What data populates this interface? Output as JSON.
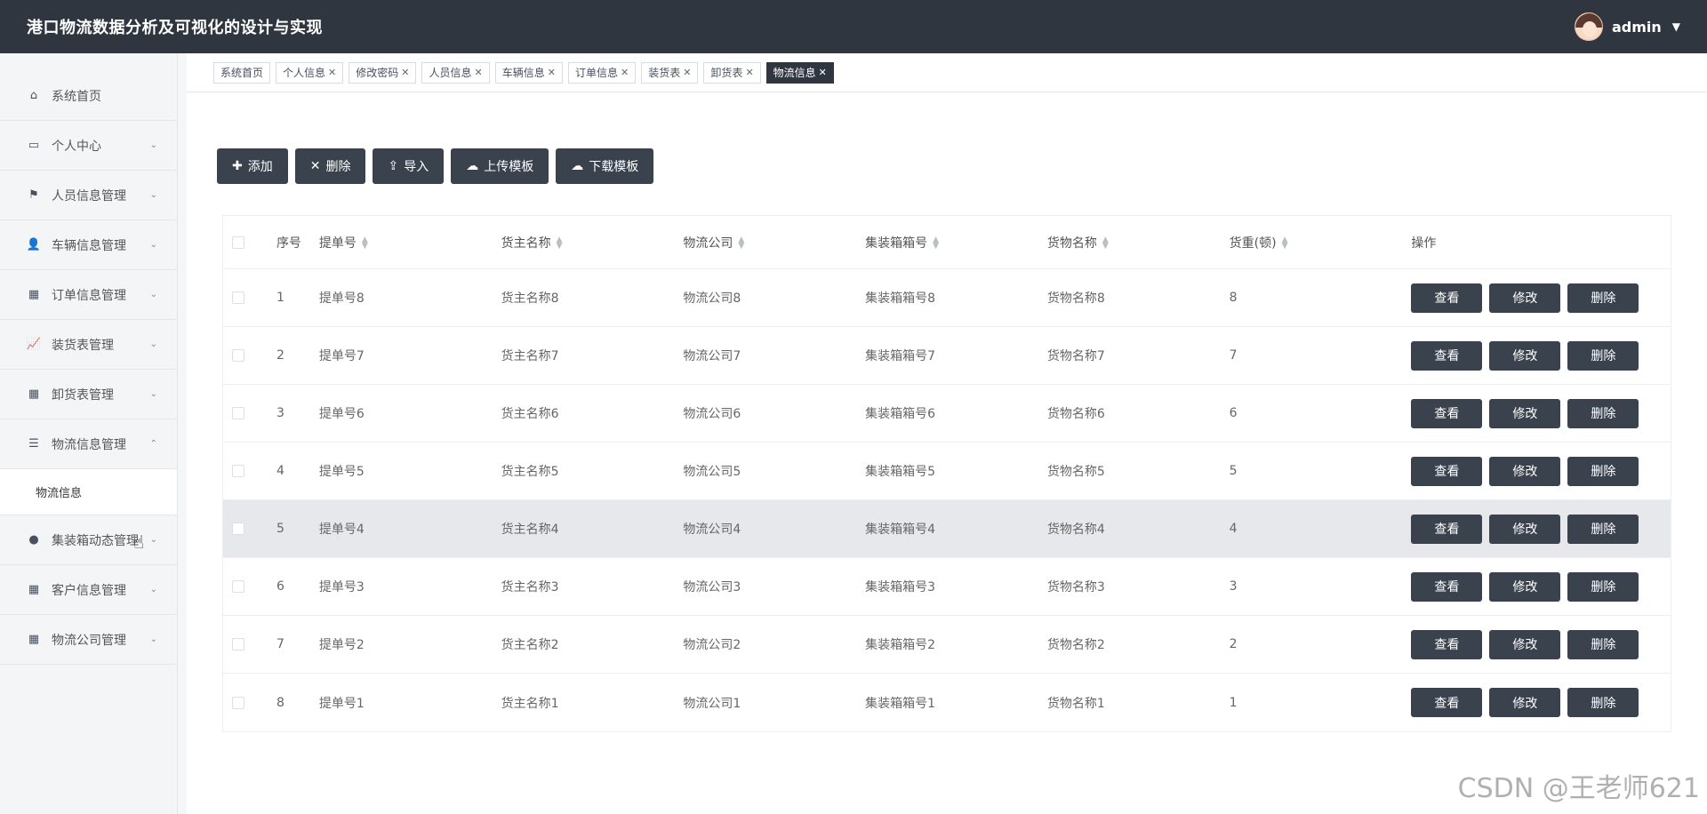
{
  "app": {
    "title": "港口物流数据分析及可视化的设计与实现",
    "user": "admin",
    "caret": "▼"
  },
  "sidebar": {
    "items": [
      {
        "label": "系统首页",
        "icon": "home-icon",
        "glyph": "⌂",
        "has_chevron": false
      },
      {
        "label": "个人中心",
        "icon": "calendar-icon",
        "glyph": "▭",
        "has_chevron": true,
        "chevron": "⌄"
      },
      {
        "label": "人员信息管理",
        "icon": "flag-icon",
        "glyph": "⚑",
        "has_chevron": true,
        "chevron": "⌄"
      },
      {
        "label": "车辆信息管理",
        "icon": "user-icon",
        "glyph": "👤",
        "has_chevron": true,
        "chevron": "⌄"
      },
      {
        "label": "订单信息管理",
        "icon": "grid-icon",
        "glyph": "▦",
        "has_chevron": true,
        "chevron": "⌄"
      },
      {
        "label": "装货表管理",
        "icon": "chart-icon",
        "glyph": "📈",
        "has_chevron": true,
        "chevron": "⌄"
      },
      {
        "label": "卸货表管理",
        "icon": "grid-icon",
        "glyph": "▦",
        "has_chevron": true,
        "chevron": "⌄"
      },
      {
        "label": "物流信息管理",
        "icon": "list-icon",
        "glyph": "☰",
        "has_chevron": true,
        "chevron": "⌃",
        "expanded": true
      },
      {
        "label": "集装箱动态管理",
        "icon": "pin-icon",
        "glyph": "●",
        "has_chevron": true,
        "chevron": "⌄"
      },
      {
        "label": "客户信息管理",
        "icon": "grid-icon",
        "glyph": "▦",
        "has_chevron": true,
        "chevron": "⌄"
      },
      {
        "label": "物流公司管理",
        "icon": "grid-icon",
        "glyph": "▦",
        "has_chevron": true,
        "chevron": "⌄"
      }
    ],
    "submenu": {
      "label": "物流信息"
    }
  },
  "tabs": [
    {
      "label": "系统首页",
      "closable": false
    },
    {
      "label": "个人信息",
      "closable": true
    },
    {
      "label": "修改密码",
      "closable": true
    },
    {
      "label": "人员信息",
      "closable": true
    },
    {
      "label": "车辆信息",
      "closable": true
    },
    {
      "label": "订单信息",
      "closable": true
    },
    {
      "label": "装货表",
      "closable": true
    },
    {
      "label": "卸货表",
      "closable": true
    },
    {
      "label": "物流信息",
      "closable": true,
      "active": true
    }
  ],
  "tab_close": "✕",
  "toolbar": [
    {
      "label": "添加",
      "icon": "plus-icon",
      "glyph": "✚"
    },
    {
      "label": "删除",
      "icon": "close-icon",
      "glyph": "✕"
    },
    {
      "label": "导入",
      "icon": "upload-icon",
      "glyph": "⇪"
    },
    {
      "label": "上传模板",
      "icon": "cloud-upload-icon",
      "glyph": "☁"
    },
    {
      "label": "下载模板",
      "icon": "cloud-download-icon",
      "glyph": "☁"
    }
  ],
  "table": {
    "headers": [
      "序号",
      "提单号",
      "货主名称",
      "物流公司",
      "集装箱箱号",
      "货物名称",
      "货重(顿)",
      "操作"
    ],
    "sortable": [
      false,
      true,
      true,
      true,
      true,
      true,
      true,
      false
    ],
    "rows": [
      [
        "1",
        "提单号8",
        "货主名称8",
        "物流公司8",
        "集装箱箱号8",
        "货物名称8",
        "8"
      ],
      [
        "2",
        "提单号7",
        "货主名称7",
        "物流公司7",
        "集装箱箱号7",
        "货物名称7",
        "7"
      ],
      [
        "3",
        "提单号6",
        "货主名称6",
        "物流公司6",
        "集装箱箱号6",
        "货物名称6",
        "6"
      ],
      [
        "4",
        "提单号5",
        "货主名称5",
        "物流公司5",
        "集装箱箱号5",
        "货物名称5",
        "5"
      ],
      [
        "5",
        "提单号4",
        "货主名称4",
        "物流公司4",
        "集装箱箱号4",
        "货物名称4",
        "4"
      ],
      [
        "6",
        "提单号3",
        "货主名称3",
        "物流公司3",
        "集装箱箱号3",
        "货物名称3",
        "3"
      ],
      [
        "7",
        "提单号2",
        "货主名称2",
        "物流公司2",
        "集装箱箱号2",
        "货物名称2",
        "2"
      ],
      [
        "8",
        "提单号1",
        "货主名称1",
        "物流公司1",
        "集装箱箱号1",
        "货物名称1",
        "1"
      ]
    ],
    "hover_row": 4,
    "actions": [
      "查看",
      "修改",
      "删除"
    ]
  },
  "watermark": "CSDN @王老师621",
  "colors": {
    "header_bg": "#2f3640",
    "button_bg": "#3a424e",
    "hover_row": "#e6e8eb"
  }
}
